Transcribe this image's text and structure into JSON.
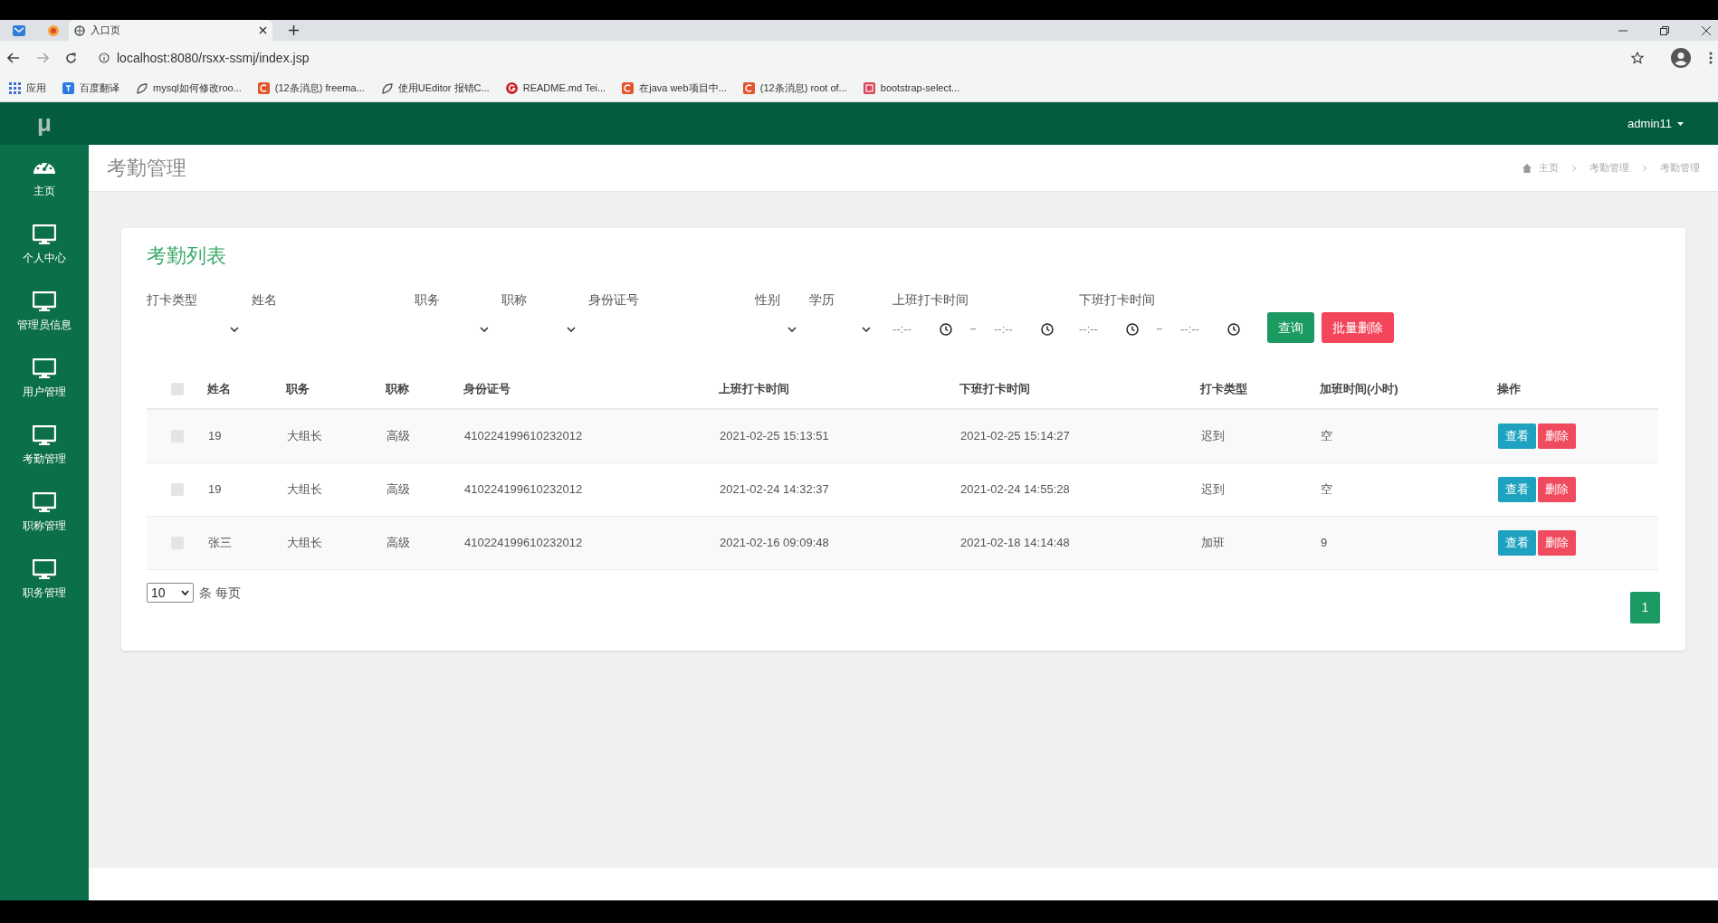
{
  "browser": {
    "tab_title": "入口页",
    "address": "localhost:8080/rsxx-ssmj/index.jsp",
    "bookmarks": [
      {
        "label": "应用",
        "kind": "apps"
      },
      {
        "label": "百度翻译",
        "kind": "translate"
      },
      {
        "label": "mysql如何修改roo...",
        "kind": "doc"
      },
      {
        "label": "(12条消息) freema...",
        "kind": "c"
      },
      {
        "label": "使用UEditor 报错C...",
        "kind": "doc"
      },
      {
        "label": "README.md  Tei...",
        "kind": "g"
      },
      {
        "label": "在java web项目中...",
        "kind": "c"
      },
      {
        "label": "(12条消息) root of...",
        "kind": "c"
      },
      {
        "label": "bootstrap-select...",
        "kind": "b"
      }
    ]
  },
  "header": {
    "logo": "μ",
    "user": "admin11"
  },
  "sidebar": {
    "items": [
      {
        "label": "主页",
        "kind": "dashboard"
      },
      {
        "label": "个人中心",
        "kind": "monitor"
      },
      {
        "label": "管理员信息",
        "kind": "monitor"
      },
      {
        "label": "用户管理",
        "kind": "monitor"
      },
      {
        "label": "考勤管理",
        "kind": "monitor"
      },
      {
        "label": "职称管理",
        "kind": "monitor"
      },
      {
        "label": "职务管理",
        "kind": "monitor"
      }
    ]
  },
  "page_title": "考勤管理",
  "breadcrumb": [
    "主页",
    "考勤管理",
    "考勤管理"
  ],
  "card_title": "考勤列表",
  "filters": [
    {
      "label": "打卡类型",
      "kind": "select"
    },
    {
      "label": "姓名",
      "kind": "text"
    },
    {
      "label": "职务",
      "kind": "select"
    },
    {
      "label": "职称",
      "kind": "select"
    },
    {
      "label": "身份证号",
      "kind": "text"
    },
    {
      "label": "性别",
      "kind": "select"
    },
    {
      "label": "学历",
      "kind": "select"
    },
    {
      "label": "上班打卡时间",
      "kind": "time_range",
      "from": "--:--",
      "to": "--:--"
    },
    {
      "label": "下班打卡时间",
      "kind": "time_range",
      "from": "--:--",
      "to": "--:--"
    }
  ],
  "buttons": [
    {
      "label": "查询",
      "kind": "search"
    },
    {
      "label": "批量删除",
      "kind": "danger"
    }
  ],
  "table": {
    "select_all": {
      "checked": false
    },
    "columns": [
      "姓名",
      "职务",
      "职称",
      "身份证号",
      "上班打卡时间",
      "下班打卡时间",
      "打卡类型",
      "加班时间(小时)",
      "操作"
    ],
    "rows": [
      {
        "checked": false,
        "cells": [
          "19",
          "大组长",
          "高级",
          "410224199610232012",
          "2021-02-25 15:13:51",
          "2021-02-25 15:14:27",
          "迟到",
          "空"
        ],
        "actions": [
          "查看",
          "删除"
        ]
      },
      {
        "checked": false,
        "cells": [
          "19",
          "大组长",
          "高级",
          "410224199610232012",
          "2021-02-24 14:32:37",
          "2021-02-24 14:55:28",
          "迟到",
          "空"
        ],
        "actions": [
          "查看",
          "删除"
        ]
      },
      {
        "checked": false,
        "cells": [
          "张三",
          "大组长",
          "高级",
          "410224199610232012",
          "2021-02-16 09:09:48",
          "2021-02-18 14:14:48",
          "加班",
          "9"
        ],
        "actions": [
          "查看",
          "删除"
        ]
      }
    ]
  },
  "page_size": {
    "value": "10",
    "suffix": "条 每页"
  },
  "pagination": [
    {
      "label": "1",
      "selected": true
    }
  ]
}
